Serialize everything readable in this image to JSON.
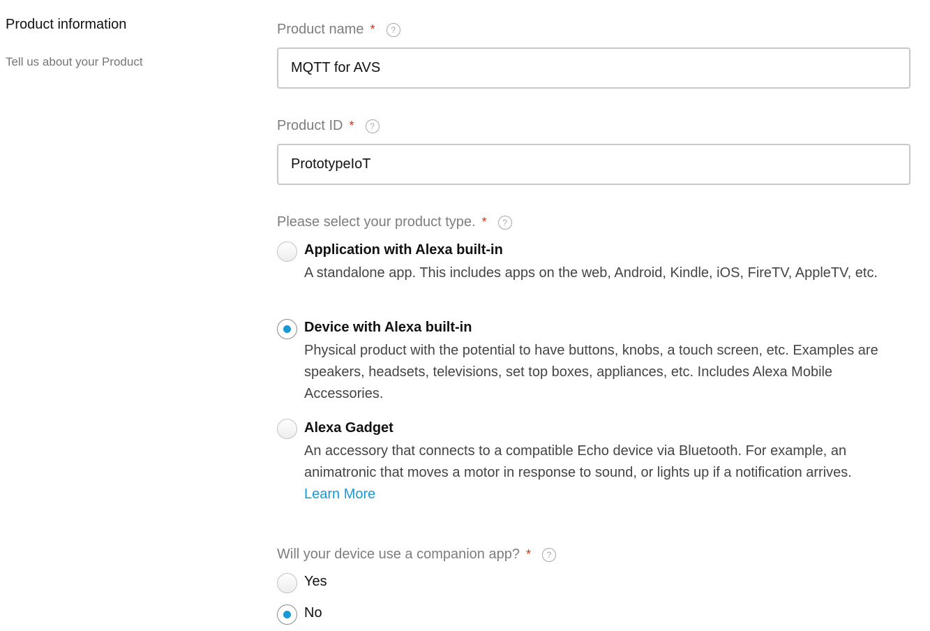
{
  "section": {
    "title": "Product information",
    "subtitle": "Tell us about your Product"
  },
  "product_name": {
    "label": "Product name",
    "required_mark": "*",
    "value": "MQTT for AVS"
  },
  "product_id": {
    "label": "Product ID",
    "required_mark": "*",
    "value": "PrototypeIoT"
  },
  "product_type": {
    "label": "Please select your product type.",
    "required_mark": "*",
    "options": [
      {
        "title": "Application with Alexa built-in",
        "description": "A standalone app. This includes apps on the web, Android, Kindle, iOS, FireTV, AppleTV, etc.",
        "selected": false
      },
      {
        "title": "Device with Alexa built-in",
        "description": "Physical product with the potential to have buttons, knobs, a touch screen, etc. Examples are speakers, headsets, televisions, set top boxes, appliances, etc. Includes Alexa Mobile Accessories.",
        "selected": true
      },
      {
        "title": "Alexa Gadget",
        "description": "An accessory that connects to a compatible Echo device via Bluetooth. For example, an animatronic that moves a motor in response to sound, or lights up if a notification arrives.",
        "link": "Learn More",
        "selected": false
      }
    ]
  },
  "companion_app": {
    "label": "Will your device use a companion app?",
    "required_mark": "*",
    "options": [
      {
        "label": "Yes",
        "selected": false
      },
      {
        "label": "No",
        "selected": true
      }
    ]
  },
  "icons": {
    "help": "?"
  },
  "colors": {
    "accent": "#1a98d5",
    "required": "#d13212",
    "label": "#7d7d7d"
  }
}
